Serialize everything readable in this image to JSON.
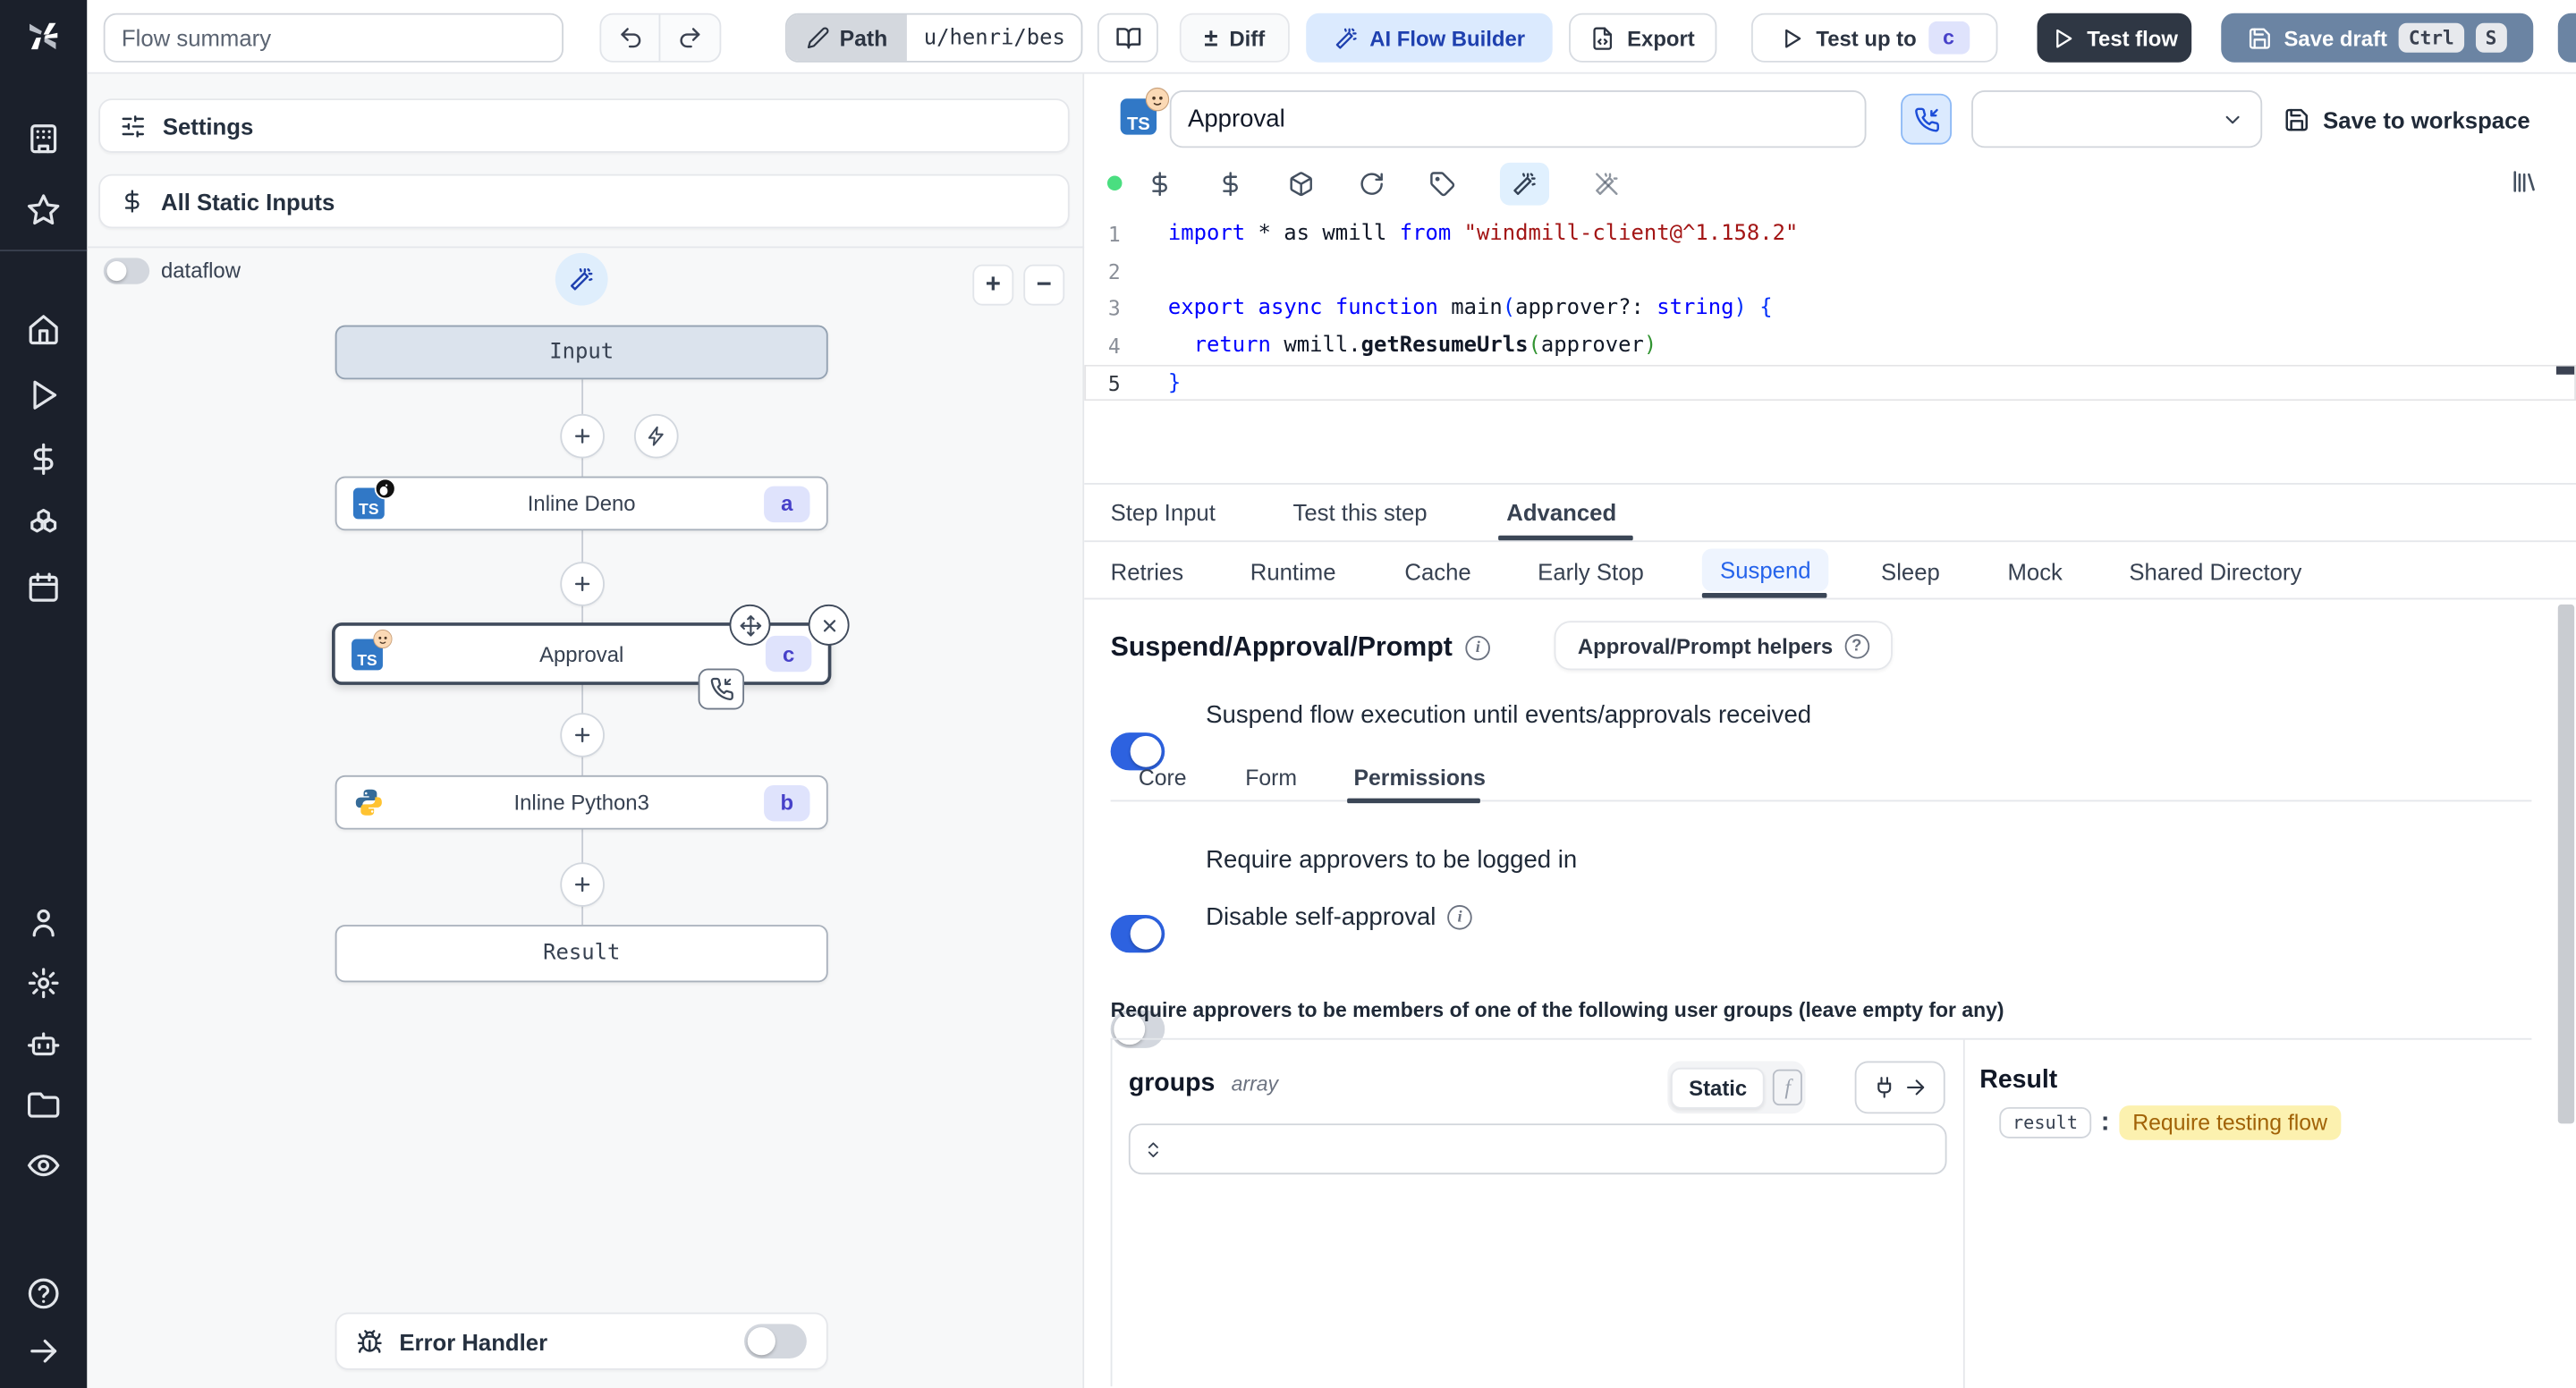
{
  "topbar": {
    "flow_summary_placeholder": "Flow summary",
    "path_label": "Path",
    "path_value": "u/henri/bes",
    "diff_pm": "±",
    "diff_label": "Diff",
    "ai_flow_builder_label": "AI Flow Builder",
    "export_label": "Export",
    "test_up_to_label": "Test up to",
    "test_up_to_badge": "c",
    "test_flow_label": "Test flow",
    "save_draft_label": "Save draft",
    "kbd_ctrl": "Ctrl",
    "kbd_s": "S"
  },
  "sidebar": {
    "icons": [
      "windmill-logo",
      "building",
      "star",
      "home",
      "runs-play",
      "variables-dollar",
      "resources-box",
      "schedules-calendar",
      "user",
      "settings-gear",
      "workers-robot",
      "folders",
      "audit-eye",
      "help-circle",
      "expand-arrow-right"
    ]
  },
  "flow_panel": {
    "settings_label": "Settings",
    "all_static_inputs_label": "All Static Inputs",
    "dataflow_label": "dataflow",
    "zoom_in_label": "+",
    "zoom_out_label": "−",
    "nodes": {
      "input": {
        "label": "Input"
      },
      "deno": {
        "label": "Inline Deno",
        "badge": "a",
        "lang": "TS"
      },
      "approval": {
        "label": "Approval",
        "badge": "c",
        "lang": "TS"
      },
      "python": {
        "label": "Inline Python3",
        "badge": "b"
      },
      "result": {
        "label": "Result"
      }
    },
    "error_handler_label": "Error Handler"
  },
  "step_panel": {
    "name_value": "Approval",
    "lang_badge": "TS",
    "save_to_workspace_label": "Save to workspace",
    "code": {
      "lines": [
        {
          "n": "1",
          "tokens": [
            [
              "k",
              "import"
            ],
            [
              "p",
              " * as wmill "
            ],
            [
              "k",
              "from"
            ],
            [
              "p",
              " "
            ],
            [
              "s",
              "\"windmill-client@^1.158.2\""
            ]
          ]
        },
        {
          "n": "2",
          "tokens": []
        },
        {
          "n": "3",
          "tokens": [
            [
              "k",
              "export"
            ],
            [
              "p",
              " "
            ],
            [
              "k",
              "async"
            ],
            [
              "p",
              " "
            ],
            [
              "k",
              "function"
            ],
            [
              "p",
              " main"
            ],
            [
              "b1",
              "("
            ],
            [
              "p",
              "approver?: "
            ],
            [
              "k",
              "string"
            ],
            [
              "b1",
              ")"
            ],
            [
              "p",
              " "
            ],
            [
              "b1",
              "{"
            ]
          ]
        },
        {
          "n": "4",
          "tokens": [
            [
              "p",
              "  "
            ],
            [
              "k",
              "return"
            ],
            [
              "p",
              " wmill."
            ],
            [
              "f",
              "getResumeUrls"
            ],
            [
              "b2",
              "("
            ],
            [
              "p",
              "approver"
            ],
            [
              "b2",
              ")"
            ]
          ]
        },
        {
          "n": "5",
          "active": true,
          "tokens": [
            [
              "b1",
              "}"
            ]
          ]
        }
      ]
    },
    "tabs": {
      "step_input": "Step Input",
      "test_this_step": "Test this step",
      "advanced": "Advanced"
    },
    "advanced_tabs": {
      "retries": "Retries",
      "runtime": "Runtime",
      "cache": "Cache",
      "early_stop": "Early Stop",
      "suspend": "Suspend",
      "sleep": "Sleep",
      "mock": "Mock",
      "shared_directory": "Shared Directory"
    },
    "suspend": {
      "title": "Suspend/Approval/Prompt",
      "helpers_button_label": "Approval/Prompt helpers",
      "suspend_toggle_label": "Suspend flow execution until events/approvals received",
      "subtabs": {
        "core": "Core",
        "form": "Form",
        "permissions": "Permissions"
      },
      "require_login_label": "Require approvers to be logged in",
      "disable_self_approval_label": "Disable self-approval",
      "groups_note": "Require approvers to be members of one of the following user groups (leave empty for any)",
      "groups_label": "groups",
      "groups_type": "array",
      "static_label": "Static",
      "fx_label": "f",
      "result_title": "Result",
      "result_key": "result",
      "result_colon": ":",
      "result_value": "Require testing flow"
    }
  },
  "colors": {
    "accent_blue": "#2d62e0",
    "sidebar_bg": "#1b202b",
    "test_flow_bg": "#2f3744",
    "save_draft_bg": "#6b84a3",
    "ai_builder_bg": "#dbeafe",
    "badge_bg": "#dfe3fc",
    "badge_text": "#4741c9",
    "highlight_yellow_bg": "#fcf1af",
    "highlight_yellow_text": "#a16207",
    "suspend_tab_text": "#2563eb"
  }
}
